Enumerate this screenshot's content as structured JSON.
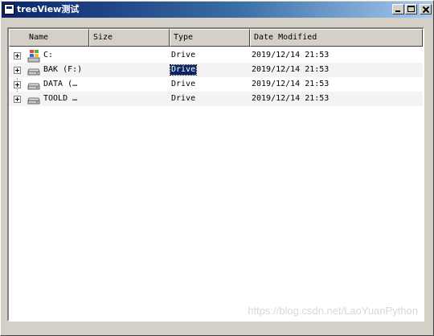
{
  "window": {
    "title": "treeView测试"
  },
  "columns": [
    {
      "label": "Name"
    },
    {
      "label": "Size"
    },
    {
      "label": "Type"
    },
    {
      "label": "Date Modified"
    }
  ],
  "rows": [
    {
      "name": "C:",
      "size": "",
      "type": "Drive",
      "date": "2019/12/14 21:53",
      "icon": "windows-drive-icon"
    },
    {
      "name": "BAK (F:)",
      "size": "",
      "type": "Drive",
      "date": "2019/12/14 21:53",
      "icon": "hard-drive-icon",
      "type_selected": true
    },
    {
      "name": "DATA (…",
      "size": "",
      "type": "Drive",
      "date": "2019/12/14 21:53",
      "icon": "hard-drive-icon"
    },
    {
      "name": "TOOLD …",
      "size": "",
      "type": "Drive",
      "date": "2019/12/14 21:53",
      "icon": "hard-drive-icon"
    }
  ],
  "watermark": "https://blog.csdn.net/LaoYuanPython"
}
